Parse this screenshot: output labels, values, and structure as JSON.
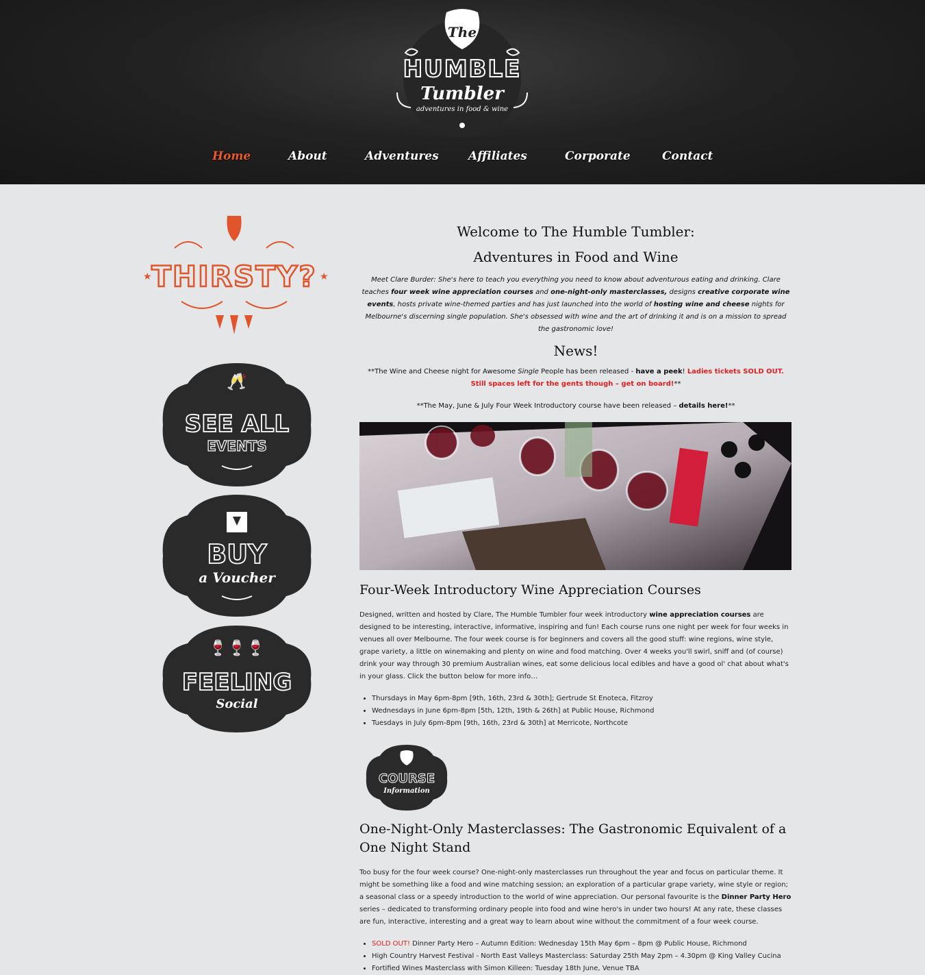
{
  "brand": {
    "logo_the": "The",
    "logo_humble": "HUMBLE",
    "logo_tumbler": "Tumbler",
    "logo_tagline": "adventures in food & wine",
    "accent": "#e85a2c"
  },
  "nav": {
    "home": "Home",
    "about": "About",
    "adventures": "Adventures",
    "affiliates": "Affiliates",
    "corporate": "Corporate",
    "contact": "Contact"
  },
  "sidebar": {
    "thirsty": "THIRSTY?",
    "see_all_1": "SEE ALL",
    "see_all_2": "EVENTS",
    "buy_1": "BUY",
    "buy_2": "a Voucher",
    "feeling_1": "FEELING",
    "feeling_2": "Social"
  },
  "welcome": {
    "line1": "Welcome to The Humble Tumbler:",
    "line2": "Adventures in Food and Wine"
  },
  "intro": {
    "p1": "Meet Clare Burder: She's here to teach you everything you need to know about adventurous eating and drinking.  Clare teaches ",
    "b1": "four week wine appreciation courses",
    "p2": " and ",
    "b2": "one-night-only masterclasses,",
    "p3": " designs ",
    "b3": "creative corporate wine events",
    "p4": ", hosts private wine-themed parties and has just launched into the world of ",
    "b4": "hosting wine and cheese",
    "p5": " nights for Melbourne's discerning  single population. She's obsessed with wine and the art of drinking it and is on a mission to spread the gastronomic love!"
  },
  "news": {
    "title": "News!",
    "n1_a": "**The Wine and Cheese night for Awesome ",
    "n1_single": "Single",
    "n1_b": " People has been released - ",
    "n1_link": "have a peek",
    "n1_c": "! ",
    "n1_red": "Ladies tickets SOLD OUT. Still spaces left for the gents though – get on board!",
    "n1_end": "**",
    "n2_a": "**The May, June & July Four Week Introductory course have been released – ",
    "n2_link": "details here!",
    "n2_end": "**"
  },
  "courses": {
    "title": "Four-Week Introductory Wine Appreciation Courses",
    "p1": "Designed, written and hosted by Clare,  The Humble Tumbler four week introductory ",
    "b1": "wine appreciation courses",
    "p2": " are designed to be interesting, interactive, informative, inspiring and fun! Each course runs one night per week for four weeks in venues all over Melbourne. The four week course is for beginners and covers all the good stuff: wine regions, wine style, grape variety, a little on winemaking and plenty on wine and food matching. Over 4 weeks you'll swirl, sniff and (of course) drink your way through 30 premium Australian wines, eat some delicious local edibles and have a good ol' chat about what's in your glass. Click the button below for more info…",
    "schedule": [
      "Thursdays in May 6pm-8pm [9th, 16th, 23rd & 30th]; Gertrude St Enoteca, Fitzroy",
      "Wednesdays in June 6pm-8pm [5th, 12th, 19th & 26th] at Public House, Richmond",
      "Tuesdays in July 6pm-8pm [9th, 16th, 23rd & 30th] at Merricote, Northcote"
    ],
    "button_1": "COURSE",
    "button_2": "Information"
  },
  "masterclasses": {
    "title": "One-Night-Only Masterclasses: The Gastronomic Equivalent of a One Night Stand",
    "p1": "Too busy for the four week course? One-night-only masterclasses run throughout the year and focus on particular theme. It might be something like a food and wine matching session; an exploration of a particular grape variety, wine style or region; a seasonal class or a speedy introduction to the world of wine appreciation.  Our personal favourite is the ",
    "b1": "Dinner Party Hero",
    "p2": " series – dedicated to transforming ordinary people into food and wine hero's in under two hours! At any rate, these classes are fun, interactive, interesting and a great way to learn about wine without the commitment of a four week course.",
    "sold_out": "SOLD OUT!",
    "item1": " Dinner Party Hero – Autumn Edition: Wednesday 15th May 6pm – 8pm @ Public House, Richmond",
    "item2": "High Country Harvest Festival -  North East Valleys Masterclass: Saturday 25th May 2pm – 4.30pm @ King Valley Cucina",
    "item3": "Fortified Wines Masterclass with Simon Killeen: Tuesday 18th June, Venue TBA"
  }
}
